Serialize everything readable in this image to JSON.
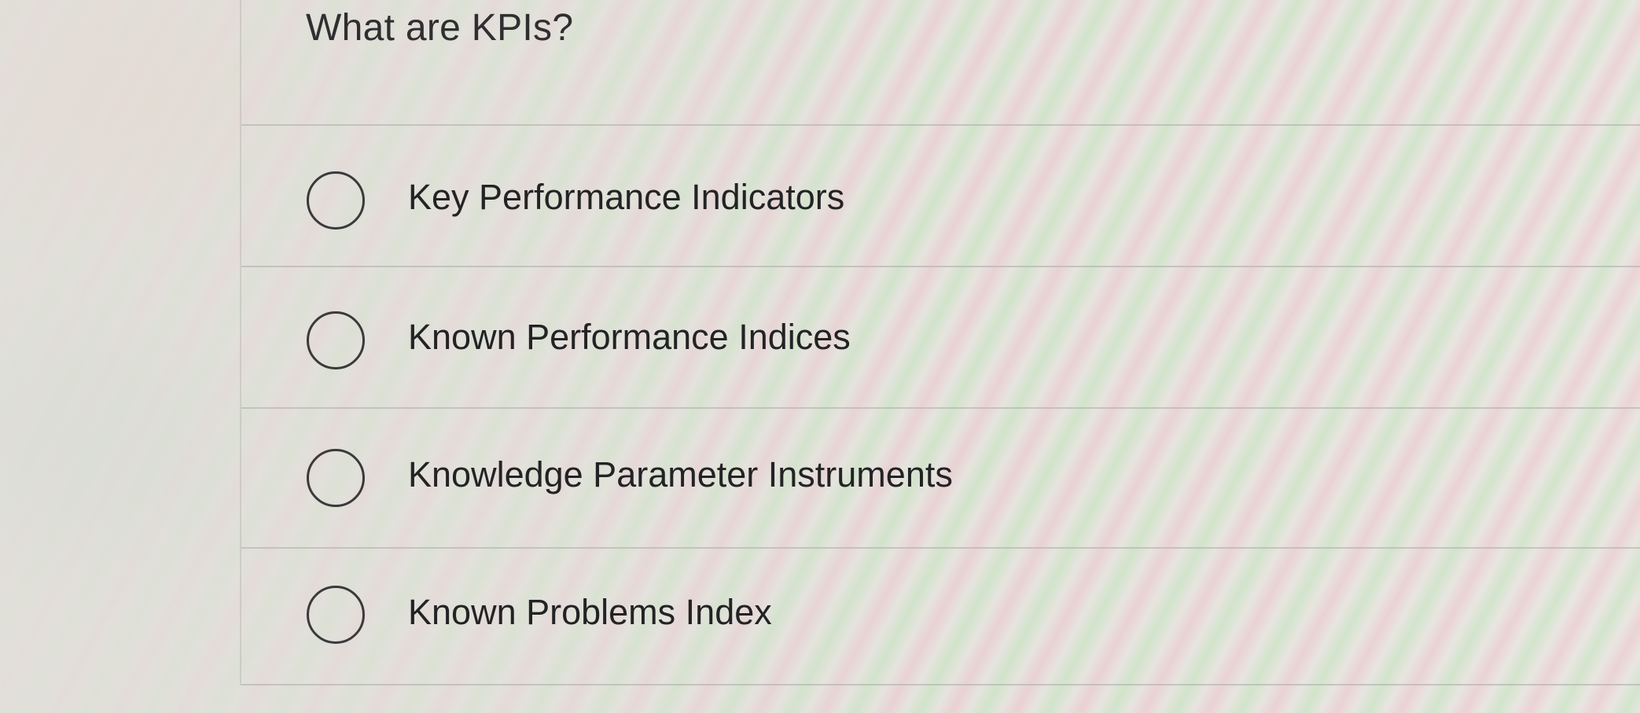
{
  "question": {
    "text": "What are KPIs?"
  },
  "options": [
    {
      "label": "Key Performance Indicators",
      "selected": false
    },
    {
      "label": "Known Performance Indices",
      "selected": false
    },
    {
      "label": "Knowledge Parameter Instruments",
      "selected": false
    },
    {
      "label": "Known Problems Index",
      "selected": false
    }
  ]
}
